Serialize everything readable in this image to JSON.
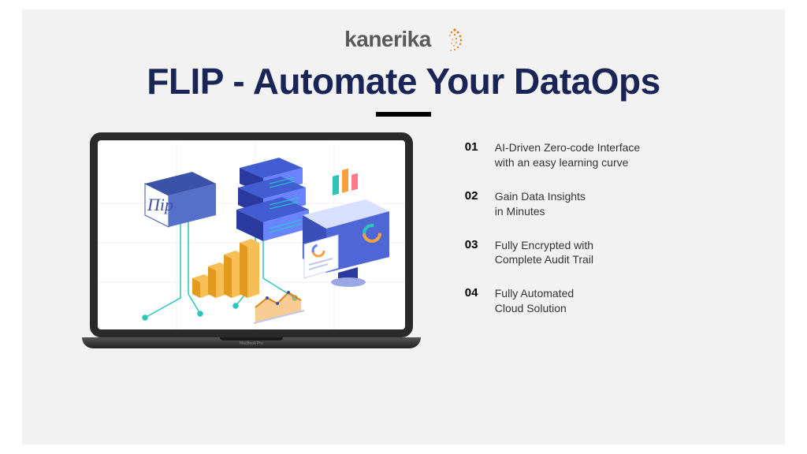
{
  "logo": {
    "text": "kanerika"
  },
  "title": "FLIP - Automate Your DataOps",
  "laptop": {
    "brand": "MacBook Pro",
    "inner_box_label": "Πip"
  },
  "features": [
    {
      "num": "01",
      "text_line1": "AI-Driven Zero-code Interface",
      "text_line2": "with an easy learning curve"
    },
    {
      "num": "02",
      "text_line1": "Gain Data Insights",
      "text_line2": "in Minutes"
    },
    {
      "num": "03",
      "text_line1": "Fully Encrypted with",
      "text_line2": "Complete Audit Trail"
    },
    {
      "num": "04",
      "text_line1": "Fully Automated",
      "text_line2": "Cloud Solution"
    }
  ]
}
